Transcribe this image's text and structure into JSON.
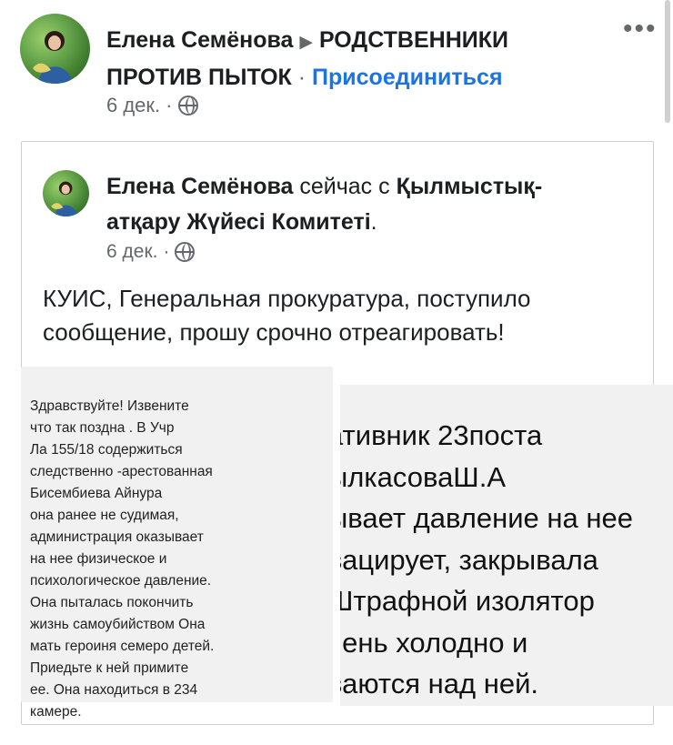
{
  "header": {
    "author": "Елена Семёнова",
    "arrow": "▶",
    "group_line1": "РОДСТВЕННИКИ",
    "group_line2": "ПРОТИВ ПЫТОК",
    "separator": "·",
    "join_label": "Присоединиться",
    "timestamp": "6 дек.",
    "dot": "·",
    "more_icon": "more-dots-icon"
  },
  "shared_post": {
    "author": "Елена Семёнова",
    "with_text": "сейчас с",
    "entity_line1": "Қылмыстық-",
    "entity_line2": "атқару Жүйесі Комитеті",
    "entity_period": ".",
    "timestamp": "6 дек.",
    "dot": "·",
    "body": "КУИС, Генеральная прокуратура, поступило сообщение, прошу срочно отреагировать!"
  },
  "images": {
    "left_message_lines": [
      "Здравствуйте! Извените",
      "что так поздна . В Учр",
      "Ла 155/18 содержиться",
      "следственно -арестованная",
      "Бисембиева Айнура",
      "она ранее не судимая,",
      "администрация оказывает",
      "на нее физическое и",
      "психологическое давление.",
      "Она пыталась покончить",
      "жизнь самоубийством Она",
      "мать героиня семеро детей.",
      "Приедьте к ней примите",
      "ее. Она находиться в 234",
      "камере."
    ],
    "right_message_lines": [
      "ативник 23поста",
      "ылкасоваШ.А",
      "ывает давление на нее",
      "вацирует, закрывала",
      "Штрафной изолятор",
      "чень холодно и",
      "ваются над ней."
    ]
  },
  "colors": {
    "link": "#1b74e4",
    "muted": "#65676b",
    "text": "#1c1e21"
  }
}
